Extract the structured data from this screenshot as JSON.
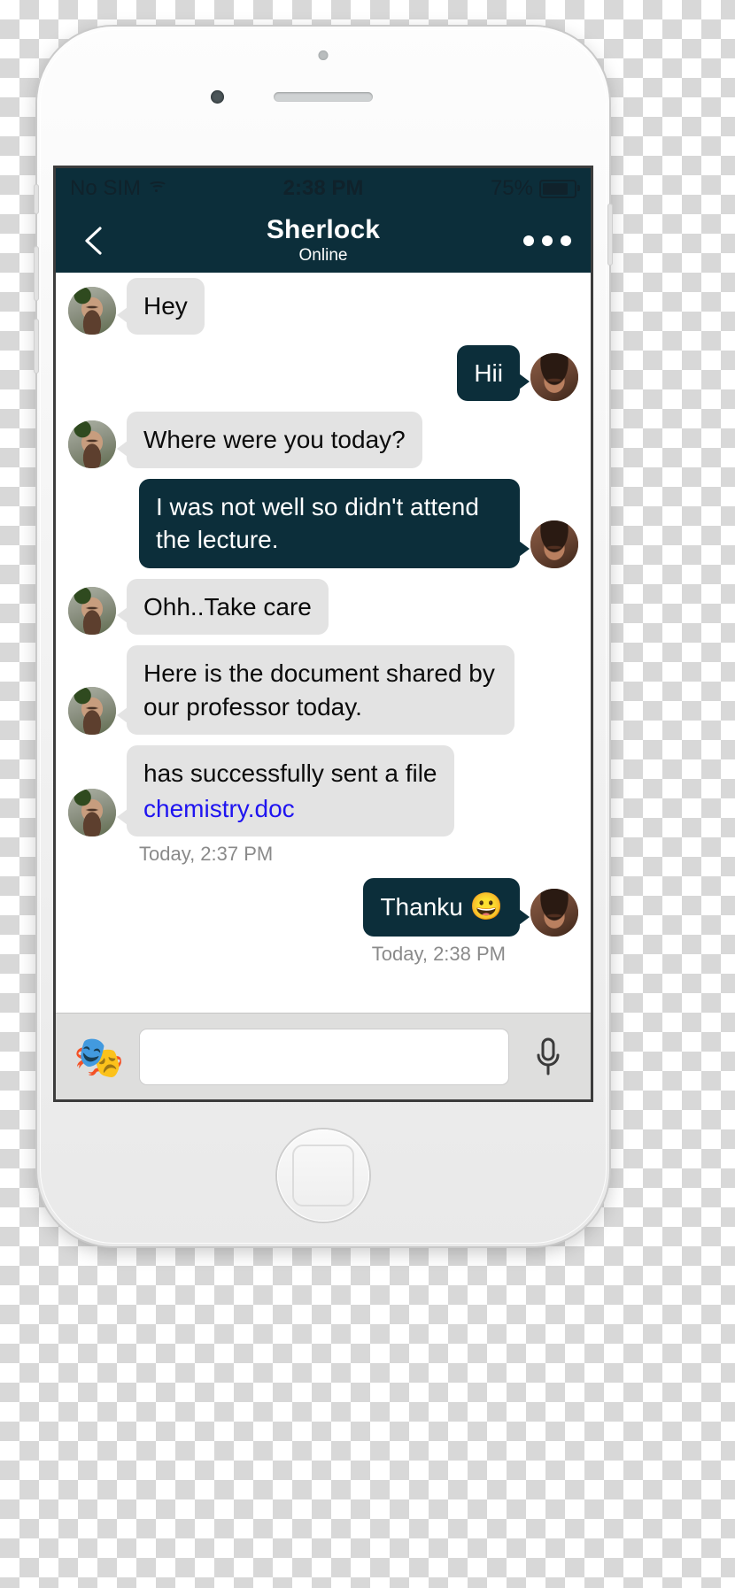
{
  "status_bar": {
    "carrier": "No SIM",
    "wifi_icon": "wifi-icon",
    "time": "2:38 PM",
    "battery_percent": "75%",
    "battery_icon": "battery-icon",
    "battery_level": 74
  },
  "nav_bar": {
    "back_icon": "chevron-left-icon",
    "title": "Sherlock",
    "subtitle": "Online",
    "menu_icon": "more-options-icon"
  },
  "messages": [
    {
      "id": 1,
      "side": "in",
      "text": "Hey",
      "avatar": "contact-avatar"
    },
    {
      "id": 2,
      "side": "out",
      "text": "Hii",
      "avatar": "user-avatar"
    },
    {
      "id": 3,
      "side": "in",
      "text": "Where were you today?",
      "avatar": "contact-avatar"
    },
    {
      "id": 4,
      "side": "out",
      "text": "I was not well so didn't attend the lecture.",
      "avatar": "user-avatar"
    },
    {
      "id": 5,
      "side": "in",
      "text": "Ohh..Take care",
      "avatar": "contact-avatar"
    },
    {
      "id": 6,
      "side": "in",
      "text": "Here is the document shared by our professor today.",
      "avatar": "contact-avatar"
    },
    {
      "id": 7,
      "side": "in",
      "text": "has successfully sent a file",
      "file": "chemistry.doc",
      "avatar": "contact-avatar"
    }
  ],
  "timestamps": {
    "file_message": "Today, 2:37 PM",
    "last_message": "Today, 2:38 PM"
  },
  "last_message": {
    "side": "out",
    "text": "Thanku",
    "emoji": "😀"
  },
  "input_bar": {
    "emoji_icon": "theater-masks-icon",
    "emoji_glyph": "🎭",
    "input_value": "",
    "input_placeholder": "",
    "mic_icon": "microphone-icon"
  },
  "colors": {
    "brand_dark": "#0c2e3a",
    "incoming_bubble": "#e3e3e3",
    "link": "#1f14f0",
    "timestamp": "#8a8a8a"
  }
}
